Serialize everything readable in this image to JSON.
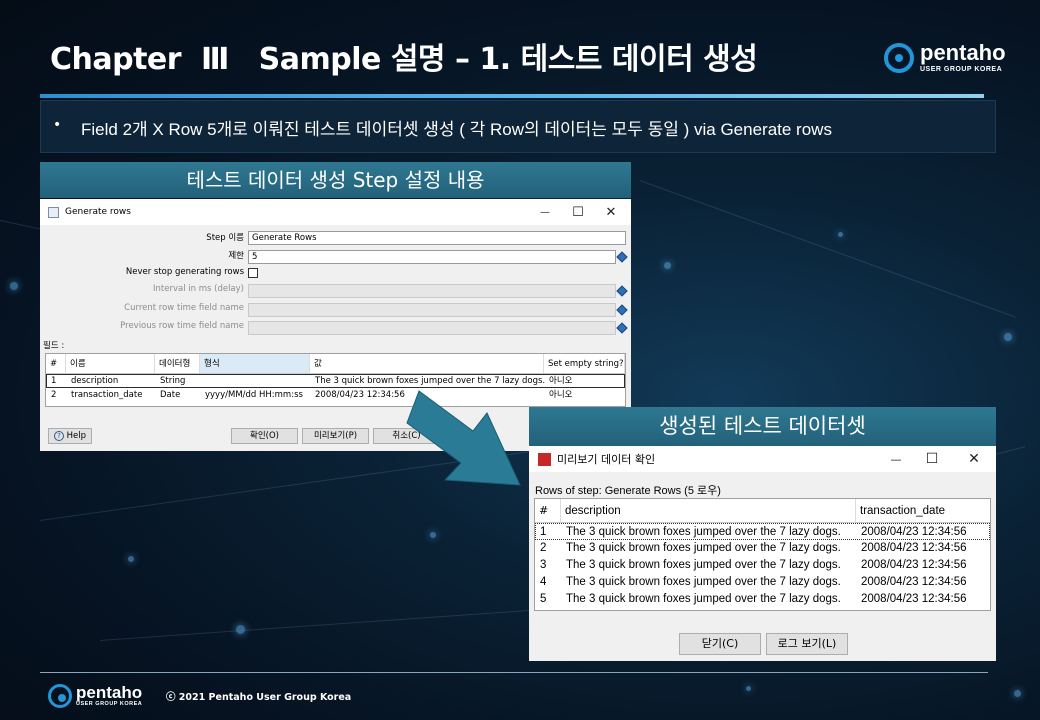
{
  "slide": {
    "title": "Chapter  Ⅲ   Sample 설명 – 1. 테스트 데이터 생성",
    "bullet": "Field 2개 X Row 5개로 이뤄진 테스트 데이터셋 생성 ( 각 Row의 데이터는 모두 동일 ) via Generate rows",
    "caption_left": "테스트 데이터 생성 Step 설정 내용",
    "caption_right": "생성된 테스트 데이터셋",
    "copyright": "ⓒ 2021 Pentaho User Group Korea",
    "logo_word": "pentaho",
    "logo_sub": "USER GROUP KOREA"
  },
  "generate_rows_dialog": {
    "title": "Generate rows",
    "minimize": "—",
    "maximize": "☐",
    "close": "✕",
    "step_name_label": "Step 이름",
    "step_name_value": "Generate Rows",
    "limit_label": "제한",
    "limit_value": "5",
    "never_stop_label": "Never stop generating rows",
    "interval_label": "Interval in ms (delay)",
    "current_time_label": "Current row time field name",
    "previous_time_label": "Previous row time field name",
    "fields_label": "필드 :",
    "columns": [
      "#",
      "이름",
      "데이터형",
      "형식",
      "값",
      "Set empty string?"
    ],
    "rows": [
      {
        "num": "1",
        "name": "description",
        "type": "String",
        "format": "",
        "value": "The 3 quick brown foxes jumped over the 7 lazy dogs.",
        "empty": "아니오"
      },
      {
        "num": "2",
        "name": "transaction_date",
        "type": "Date",
        "format": "yyyy/MM/dd HH:mm:ss",
        "value": "2008/04/23 12:34:56",
        "empty": "아니오"
      }
    ],
    "help_button": "Help",
    "ok_button": "확인(O)",
    "preview_button": "미리보기(P)",
    "cancel_button": "취소(C)"
  },
  "preview_dialog": {
    "title": "미리보기 데이터 확인",
    "minimize": "—",
    "maximize": "☐",
    "close": "✕",
    "rows_label": "Rows of step: Generate Rows (5 로우)",
    "columns": [
      "#",
      "description",
      "transaction_date"
    ],
    "rows": [
      {
        "num": "1",
        "description": "The 3 quick brown foxes jumped over the 7 lazy dogs.",
        "date": "2008/04/23 12:34:56"
      },
      {
        "num": "2",
        "description": "The 3 quick brown foxes jumped over the 7 lazy dogs.",
        "date": "2008/04/23 12:34:56"
      },
      {
        "num": "3",
        "description": "The 3 quick brown foxes jumped over the 7 lazy dogs.",
        "date": "2008/04/23 12:34:56"
      },
      {
        "num": "4",
        "description": "The 3 quick brown foxes jumped over the 7 lazy dogs.",
        "date": "2008/04/23 12:34:56"
      },
      {
        "num": "5",
        "description": "The 3 quick brown foxes jumped over the 7 lazy dogs.",
        "date": "2008/04/23 12:34:56"
      }
    ],
    "close_button": "닫기(C)",
    "log_button": "로그 보기(L)"
  },
  "colors": {
    "accent": "#2196d9",
    "caption_bg": "#2a6d86",
    "arrow": "#2a7c96"
  }
}
